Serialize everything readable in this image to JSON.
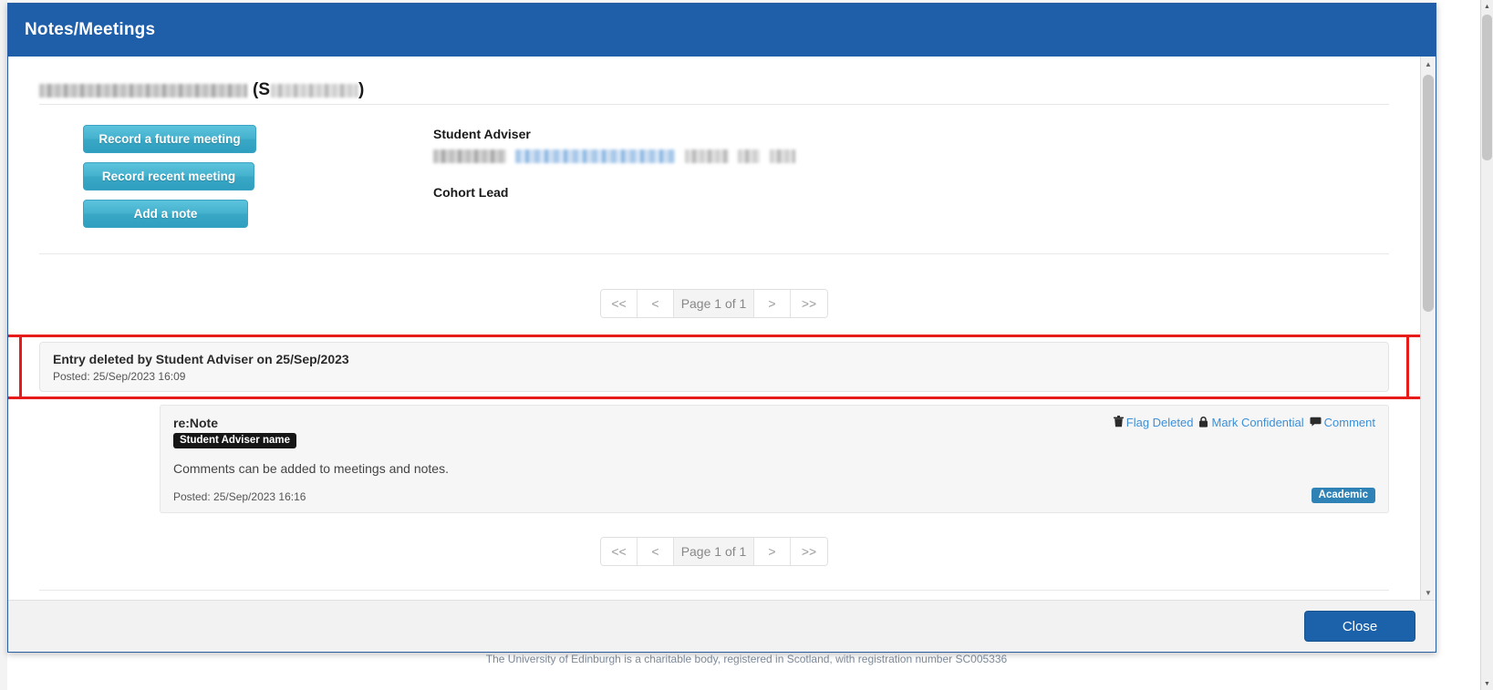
{
  "window": {
    "title": "Notes/Meetings",
    "close_label": "Close"
  },
  "student": {
    "name_redacted": "",
    "id_prefix": "(S",
    "id_suffix": ")"
  },
  "actions": {
    "record_future_meeting": "Record a future meeting",
    "record_recent_meeting": "Record recent meeting",
    "add_a_note": "Add a note"
  },
  "staff": {
    "adviser_label": "Student Adviser",
    "adviser_value_redacted": "",
    "cohort_lead_label": "Cohort Lead",
    "cohort_lead_value": ""
  },
  "pager_top": {
    "first": "<<",
    "prev": "<",
    "page_label": "Page 1 of 1",
    "next": ">",
    "last": ">>"
  },
  "pager_bottom": {
    "first": "<<",
    "prev": "<",
    "page_label": "Page 1 of 1",
    "next": ">",
    "last": ">>"
  },
  "deleted_entry": {
    "headline": "Entry deleted by Student Adviser on 25/Sep/2023",
    "posted": "Posted: 25/Sep/2023 16:09",
    "highlight_color": "#e81b1b"
  },
  "comment": {
    "subject": "re:Note",
    "author_badge": "Student Adviser name",
    "body": "Comments can be added to meetings and notes.",
    "posted": "Posted: 25/Sep/2023 16:16",
    "tag": "Academic",
    "tag_color": "#2f82b5",
    "actions": [
      {
        "icon": "trash-icon",
        "glyph": "🗑",
        "label": "Flag Deleted"
      },
      {
        "icon": "lock-icon",
        "glyph": "🔒",
        "label": "Mark Confidential"
      },
      {
        "icon": "comment-icon",
        "glyph": "🗩",
        "label": "Comment"
      }
    ]
  },
  "page_footer": {
    "text": "The University of Edinburgh is a charitable body, registered in Scotland, with registration number SC005336"
  },
  "theme": {
    "header_blue": "#1f5fa9",
    "button_teal": "#45b2ce",
    "link_blue": "#3d8fd6"
  }
}
